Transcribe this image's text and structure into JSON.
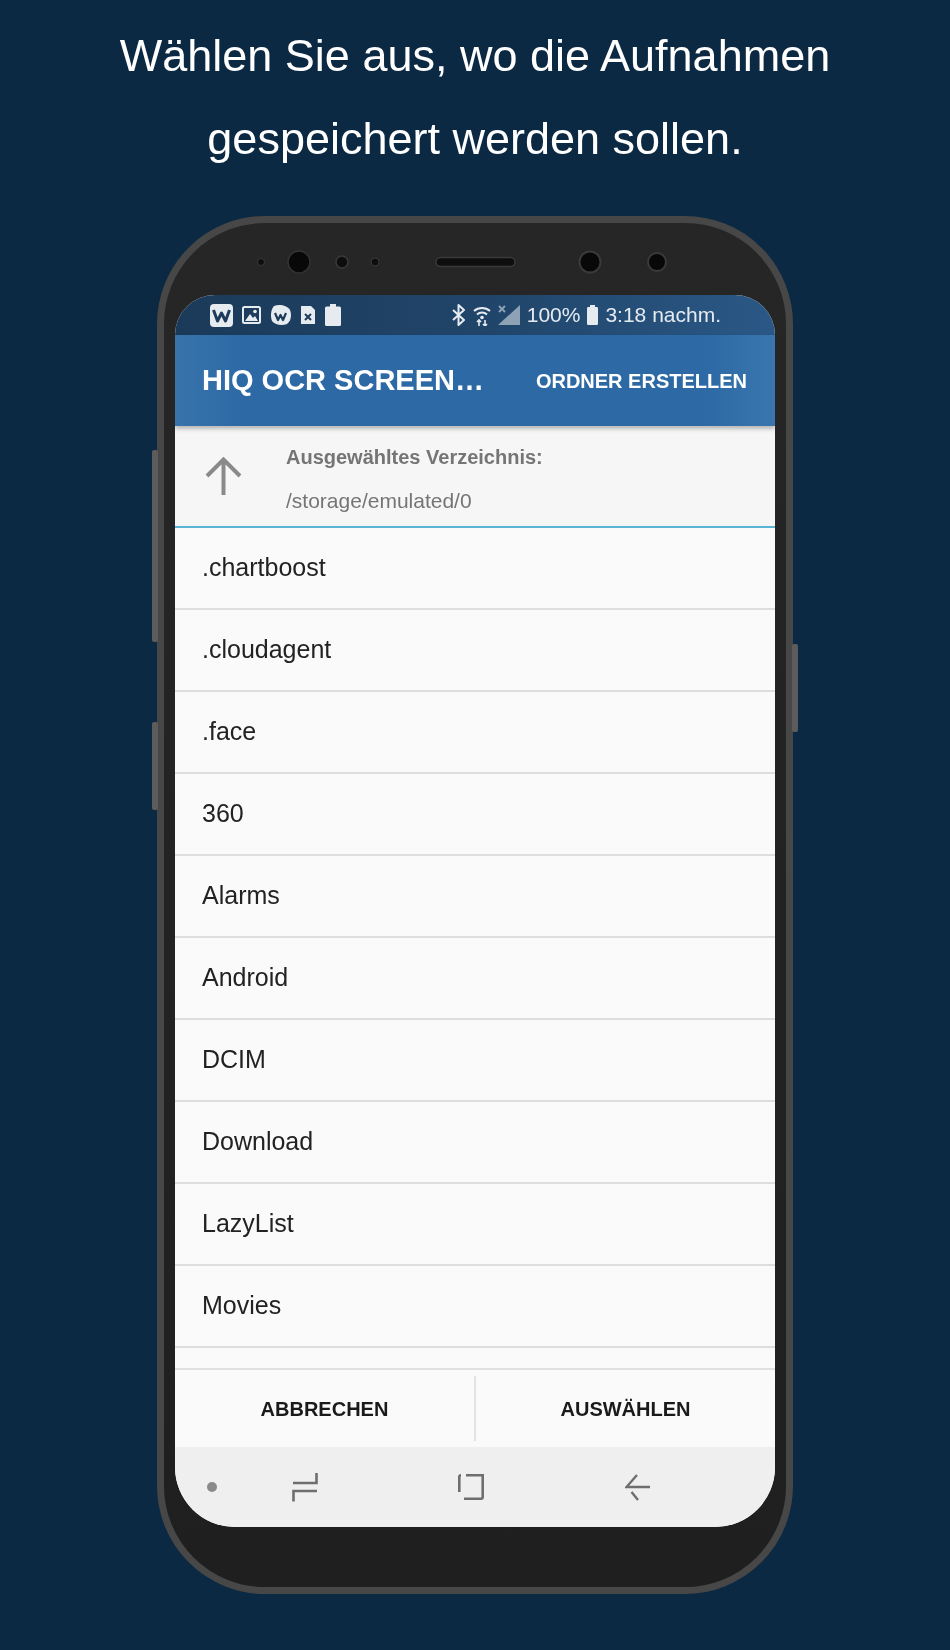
{
  "headline": "Wählen Sie aus, wo die Aufnahmen gespeichert werden sollen.",
  "status_bar": {
    "battery": "100%",
    "time": "3:18 nachm."
  },
  "app_bar": {
    "title": "HIQ OCR SCREEN…",
    "action": "ORDNER ERSTELLEN"
  },
  "directory": {
    "label": "Ausgewähltes Verzeichnis:",
    "path": "/storage/emulated/0"
  },
  "folders": [
    ".chartboost",
    ".cloudagent",
    ".face",
    "360",
    "Alarms",
    "Android",
    "DCIM",
    "Download",
    "LazyList",
    "Movies"
  ],
  "buttons": [
    "ABBRECHEN",
    "AUSWÄHLEN"
  ]
}
